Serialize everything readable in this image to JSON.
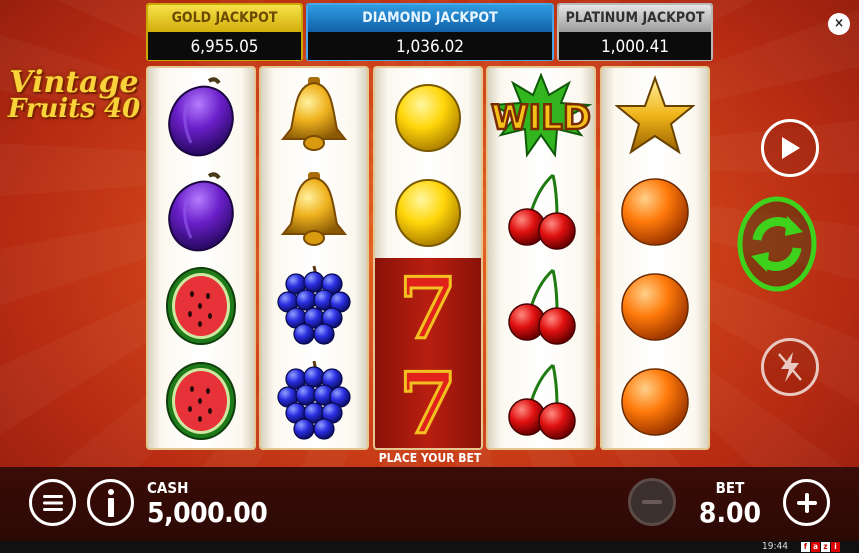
{
  "jackpots": {
    "gold": {
      "label": "GOLD JACKPOT",
      "value": "6,955.05"
    },
    "diamond": {
      "label": "DIAMOND JACKPOT",
      "value": "1,036.02"
    },
    "platinum": {
      "label": "PLATINUM JACKPOT",
      "value": "1,000.41"
    }
  },
  "close_label": "×",
  "logo": {
    "line1": "Vintage",
    "line2": "Fruits 40"
  },
  "reels": [
    [
      "plum",
      "plum",
      "watermelon",
      "watermelon"
    ],
    [
      "bell",
      "bell",
      "grapes",
      "grapes"
    ],
    [
      "lemon",
      "lemon",
      "seven",
      "seven"
    ],
    [
      "wild",
      "cherries",
      "cherries",
      "cherries"
    ],
    [
      "star",
      "orange",
      "orange",
      "orange"
    ]
  ],
  "wild_text": "WILD",
  "seven_text": "7",
  "status_message": "PLACE YOUR BET",
  "cash": {
    "label": "CASH",
    "value": "5,000.00"
  },
  "bet": {
    "label": "BET",
    "value": "8.00"
  },
  "clock": "19:44",
  "brand": [
    "f",
    "a",
    "z",
    "i"
  ],
  "icons": {
    "play": "play-icon",
    "spin": "refresh-arrows-icon",
    "turbo": "lightning-off-icon",
    "menu": "menu-icon",
    "info": "info-icon",
    "minus": "minus-icon",
    "plus": "plus-icon"
  },
  "colors": {
    "spin_button": "#3fd21c",
    "gold": "#f6e24a",
    "diamond": "#2f9be0",
    "platinum": "#c8c8c8"
  }
}
